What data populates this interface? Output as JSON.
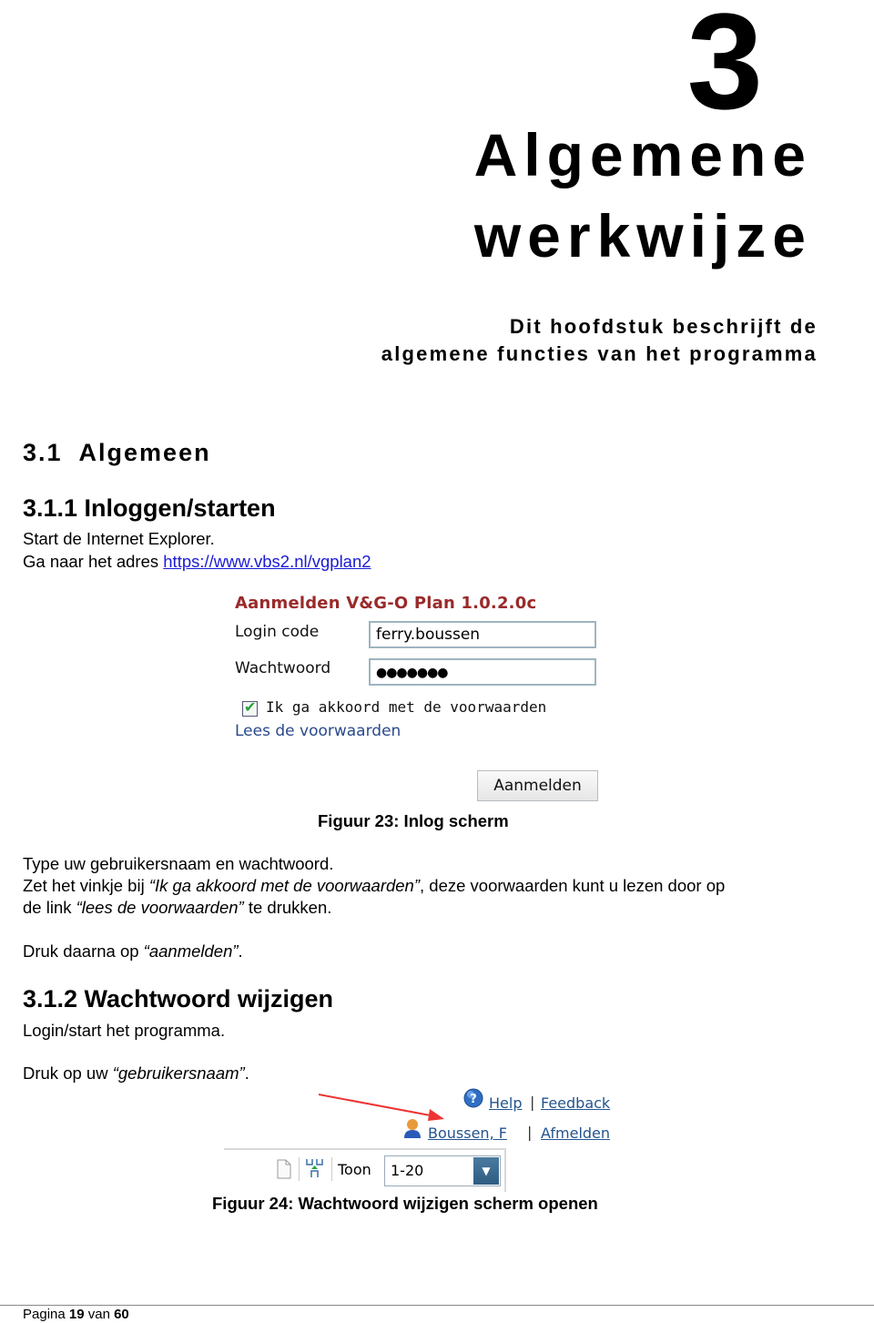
{
  "chapter": {
    "number": "3",
    "title_line1": "Algemene",
    "title_line2": "werkwijze",
    "subtitle_line1": "Dit hoofdstuk beschrijft de",
    "subtitle_line2": "algemene functies van het programma"
  },
  "section": {
    "title": "3.1  Algemeen"
  },
  "sub1": {
    "title": "3.1.1 Inloggen/starten",
    "line1": "Start de Internet Explorer.",
    "line2_prefix": "Ga naar het adres ",
    "url": "https://www.vbs2.nl/vgplan2"
  },
  "login_figure": {
    "title": "Aanmelden V&G-O Plan 1.0.2.0c",
    "login_label": "Login code",
    "login_value": "ferry.boussen",
    "password_label": "Wachtwoord",
    "password_value": "●●●●●●●",
    "checkbox_checked": true,
    "checkbox_label": "Ik ga akkoord met de voorwaarden",
    "read_terms_link": "Lees de voorwaarden",
    "submit_button": "Aanmelden",
    "caption": "Figuur 23: Inlog scherm"
  },
  "instructions": {
    "p1": "Type uw gebruikersnaam en wachtwoord.",
    "p2_a": "Zet het vinkje bij ",
    "p2_em1": "“Ik ga akkoord met de voorwaarden”",
    "p2_b": ", deze voorwaarden kunt u lezen door op",
    "p2_c": "de link ",
    "p2_em2": "“lees de voorwaarden”",
    "p2_d": " te drukken.",
    "p3_a": "Druk daarna op ",
    "p3_em": "“aanmelden”",
    "p3_b": "."
  },
  "sub2": {
    "title": "3.1.2 Wachtwoord wijzigen",
    "line1": "Login/start het programma.",
    "line2_a": "Druk op uw ",
    "line2_em": "“gebruikersnaam”",
    "line2_b": "."
  },
  "fig24": {
    "help_link": "Help",
    "feedback_link": "Feedback",
    "user_link": "Boussen, F",
    "logout_link": "Afmelden",
    "separator": "|",
    "toon_label": "Toon",
    "toon_value": "1-20",
    "caption": "Figuur 24: Wachtwoord wijzigen scherm openen"
  },
  "footer": {
    "prefix": "Pagina ",
    "page": "19",
    "mid": " van ",
    "total": "60"
  }
}
